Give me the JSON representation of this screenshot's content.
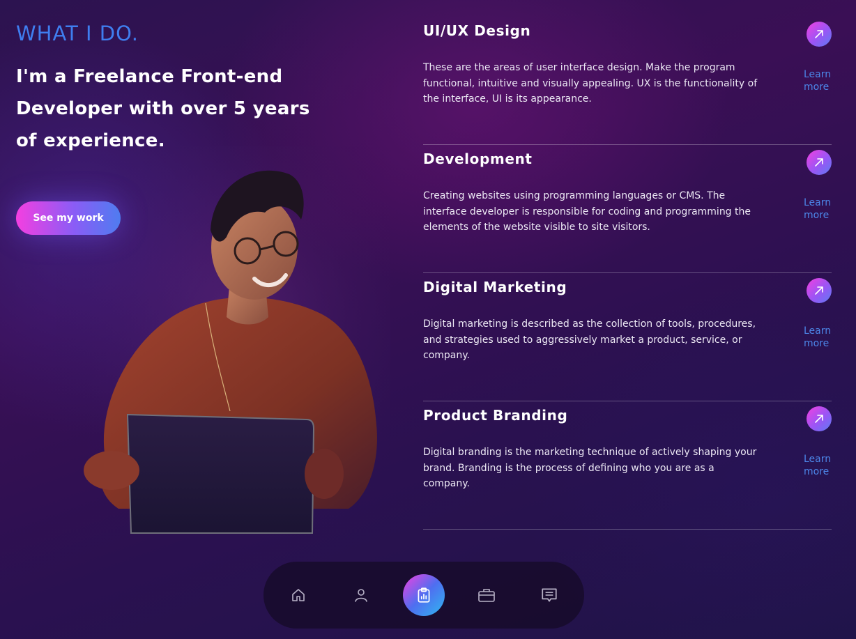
{
  "hero": {
    "section_title": "WHAT I DO.",
    "headline": "I'm a Freelance Front-end Developer with over 5 years of experience.",
    "cta_label": "See my work"
  },
  "services": [
    {
      "title": "UI/UX Design",
      "description": "These are the areas of user interface design. Make the program functional, intuitive and visually appealing. UX is the functionality of the interface, UI is its appearance.",
      "link_line1": "Learn",
      "link_line2": "more",
      "icon": "arrow-up-right-icon"
    },
    {
      "title": "Development",
      "description": "Creating websites using programming languages or CMS. The interface developer is responsible for coding and programming the elements of the website visible to site visitors.",
      "link_line1": "Learn",
      "link_line2": "more",
      "icon": "arrow-up-right-icon"
    },
    {
      "title": "Digital Marketing",
      "description": "Digital marketing is described as the collection of tools, procedures, and strategies used to aggressively market a product, service, or company.",
      "link_line1": "Learn",
      "link_line2": "more",
      "icon": "arrow-up-right-icon"
    },
    {
      "title": "Product Branding",
      "description": "Digital branding is the marketing technique of actively shaping your brand. Branding is the process of defining who you are as a company.",
      "link_line1": "Learn",
      "link_line2": "more",
      "icon": "arrow-up-right-icon"
    }
  ],
  "bottom_nav": {
    "items": [
      {
        "icon": "home-icon",
        "active": false
      },
      {
        "icon": "user-icon",
        "active": false
      },
      {
        "icon": "clipboard-chart-icon",
        "active": true
      },
      {
        "icon": "briefcase-icon",
        "active": false
      },
      {
        "icon": "message-icon",
        "active": false
      }
    ]
  },
  "colors": {
    "accent_blue": "#3f7ef0",
    "link_blue": "#4c86e8",
    "gradient_pink": "#f43fe0",
    "gradient_violet": "#8b5cf6",
    "background_deep": "#2c1350"
  }
}
